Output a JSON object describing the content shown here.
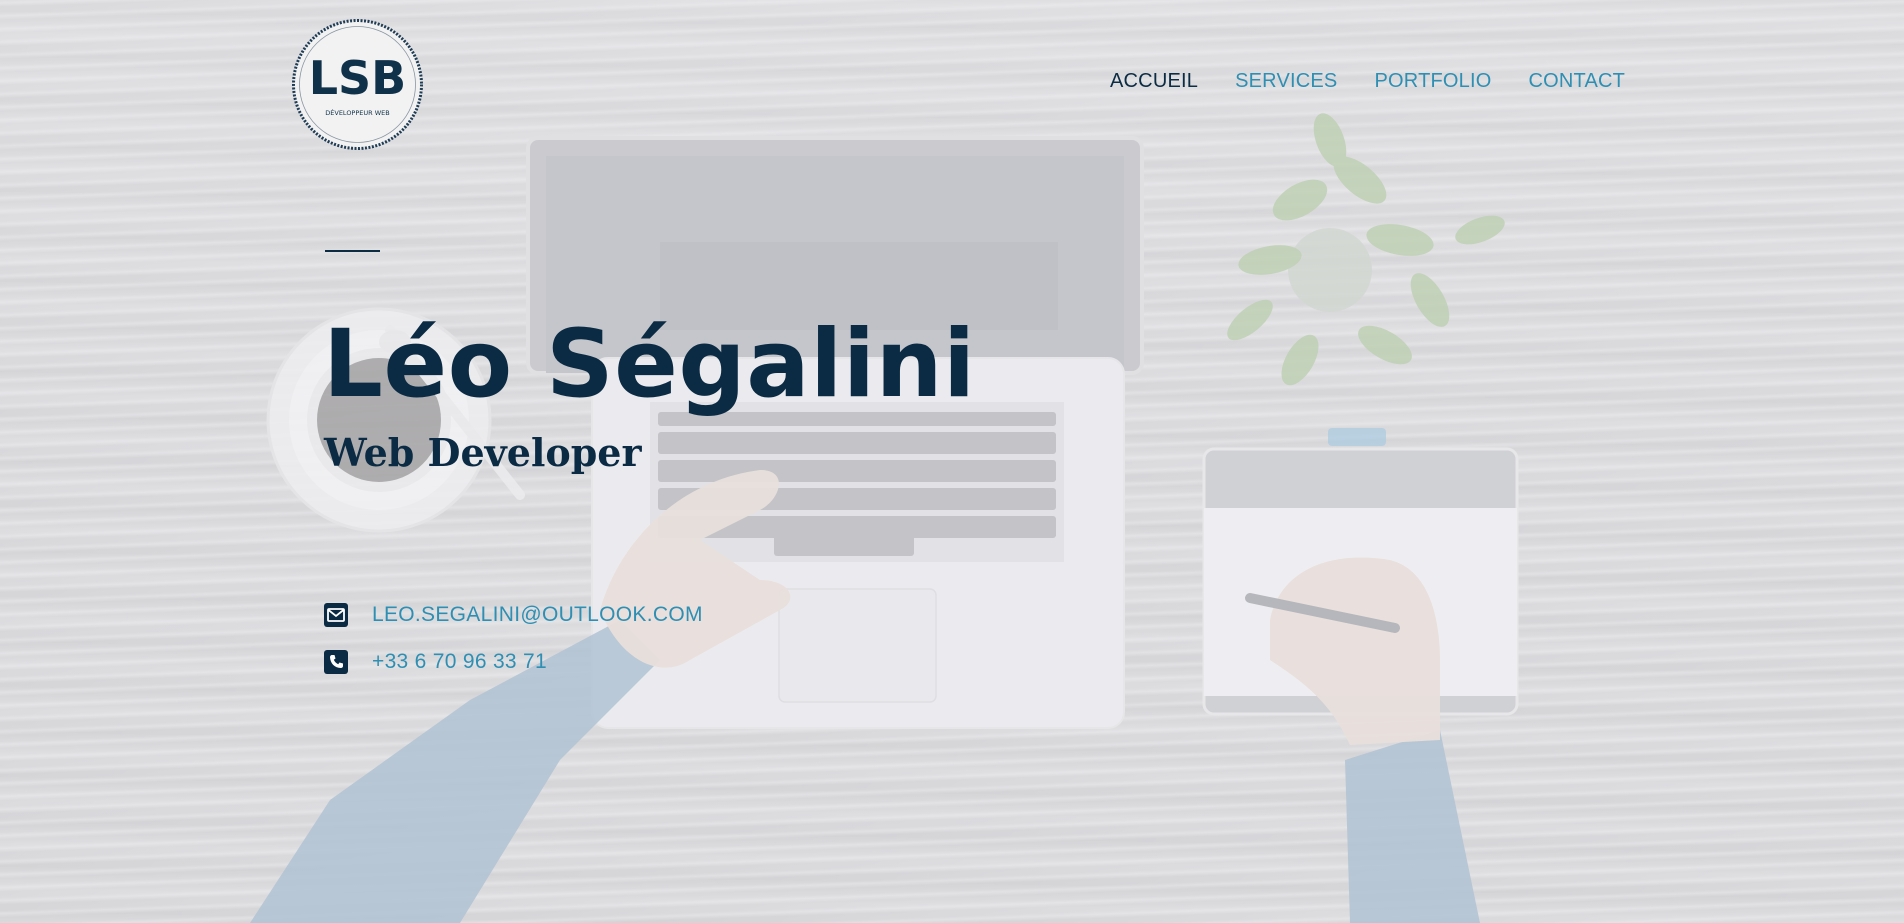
{
  "logo": {
    "letters": "LSB",
    "tagline": "DÉVELOPPEUR WEB"
  },
  "nav": {
    "items": [
      {
        "label": "ACCUEIL",
        "active": true
      },
      {
        "label": "SERVICES",
        "active": false
      },
      {
        "label": "PORTFOLIO",
        "active": false
      },
      {
        "label": "CONTACT",
        "active": false
      }
    ]
  },
  "hero": {
    "name": "Léo Ségalini",
    "role": "Web Developer"
  },
  "contact": {
    "email": "LEO.SEGALINI@OUTLOOK.COM",
    "email_icon": "envelope-icon",
    "phone": "+33 6 70 96 33 71",
    "phone_icon": "phone-icon"
  },
  "colors": {
    "primary": "#0a2b43",
    "accent": "#2e8fb3"
  }
}
